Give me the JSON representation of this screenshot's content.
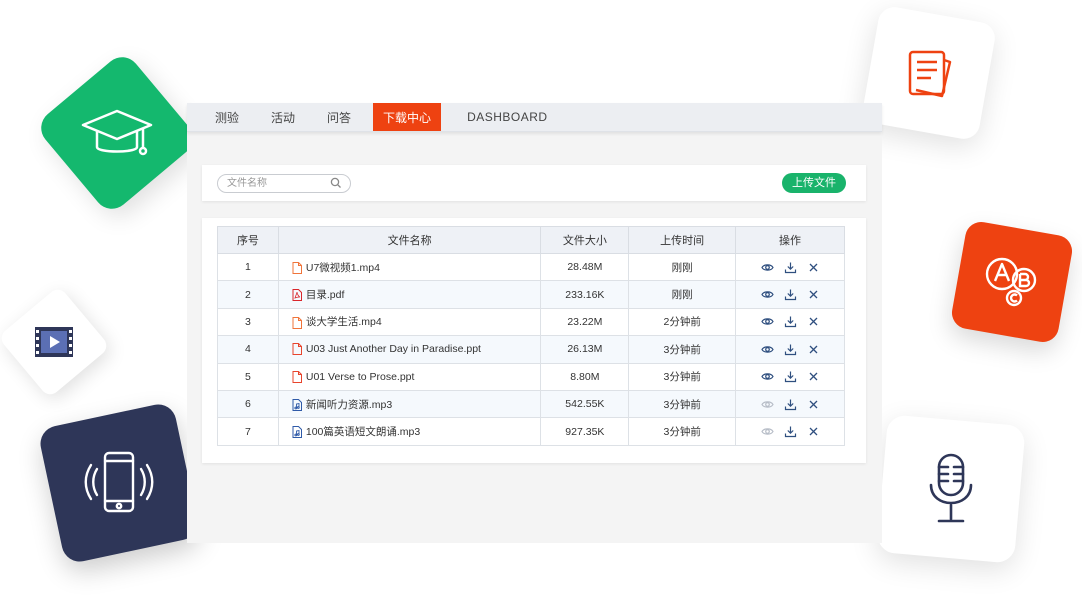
{
  "nav": {
    "tabs": [
      {
        "label": "测验"
      },
      {
        "label": "活动"
      },
      {
        "label": "问答"
      },
      {
        "label": "下载中心"
      },
      {
        "label": "DASHBOARD"
      }
    ],
    "active_index": 3
  },
  "toolbar": {
    "search_placeholder": "文件名称",
    "upload_label": "上传文件"
  },
  "table": {
    "headers": [
      "序号",
      "文件名称",
      "文件大小",
      "上传时间",
      "操作"
    ],
    "rows": [
      {
        "index": "1",
        "name": "U7微视频1.mp4",
        "size": "28.48M",
        "time": "刚刚",
        "icon": "video-file-icon",
        "preview_enabled": true
      },
      {
        "index": "2",
        "name": "目录.pdf",
        "size": "233.16K",
        "time": "刚刚",
        "icon": "pdf-file-icon",
        "preview_enabled": true
      },
      {
        "index": "3",
        "name": "谈大学生活.mp4",
        "size": "23.22M",
        "time": "2分钟前",
        "icon": "video-file-icon",
        "preview_enabled": true
      },
      {
        "index": "4",
        "name": "U03 Just Another Day in Paradise.ppt",
        "size": "26.13M",
        "time": "3分钟前",
        "icon": "ppt-file-icon",
        "preview_enabled": true
      },
      {
        "index": "5",
        "name": "U01 Verse to Prose.ppt",
        "size": "8.80M",
        "time": "3分钟前",
        "icon": "ppt-file-icon",
        "preview_enabled": true
      },
      {
        "index": "6",
        "name": "新闻听力资源.mp3",
        "size": "542.55K",
        "time": "3分钟前",
        "icon": "audio-file-icon",
        "preview_enabled": false
      },
      {
        "index": "7",
        "name": "100篇英语短文朗诵.mp3",
        "size": "927.35K",
        "time": "3分钟前",
        "icon": "audio-file-icon",
        "preview_enabled": false
      }
    ]
  },
  "colors": {
    "accent": "#ee4211",
    "green": "#19b36b",
    "navy": "#2e3658",
    "icon_blue": "#2f4f7f"
  },
  "decorations": [
    "graduation-cap-icon",
    "document-icon",
    "video-icon",
    "phone-icon",
    "abc-icon",
    "microphone-icon"
  ]
}
